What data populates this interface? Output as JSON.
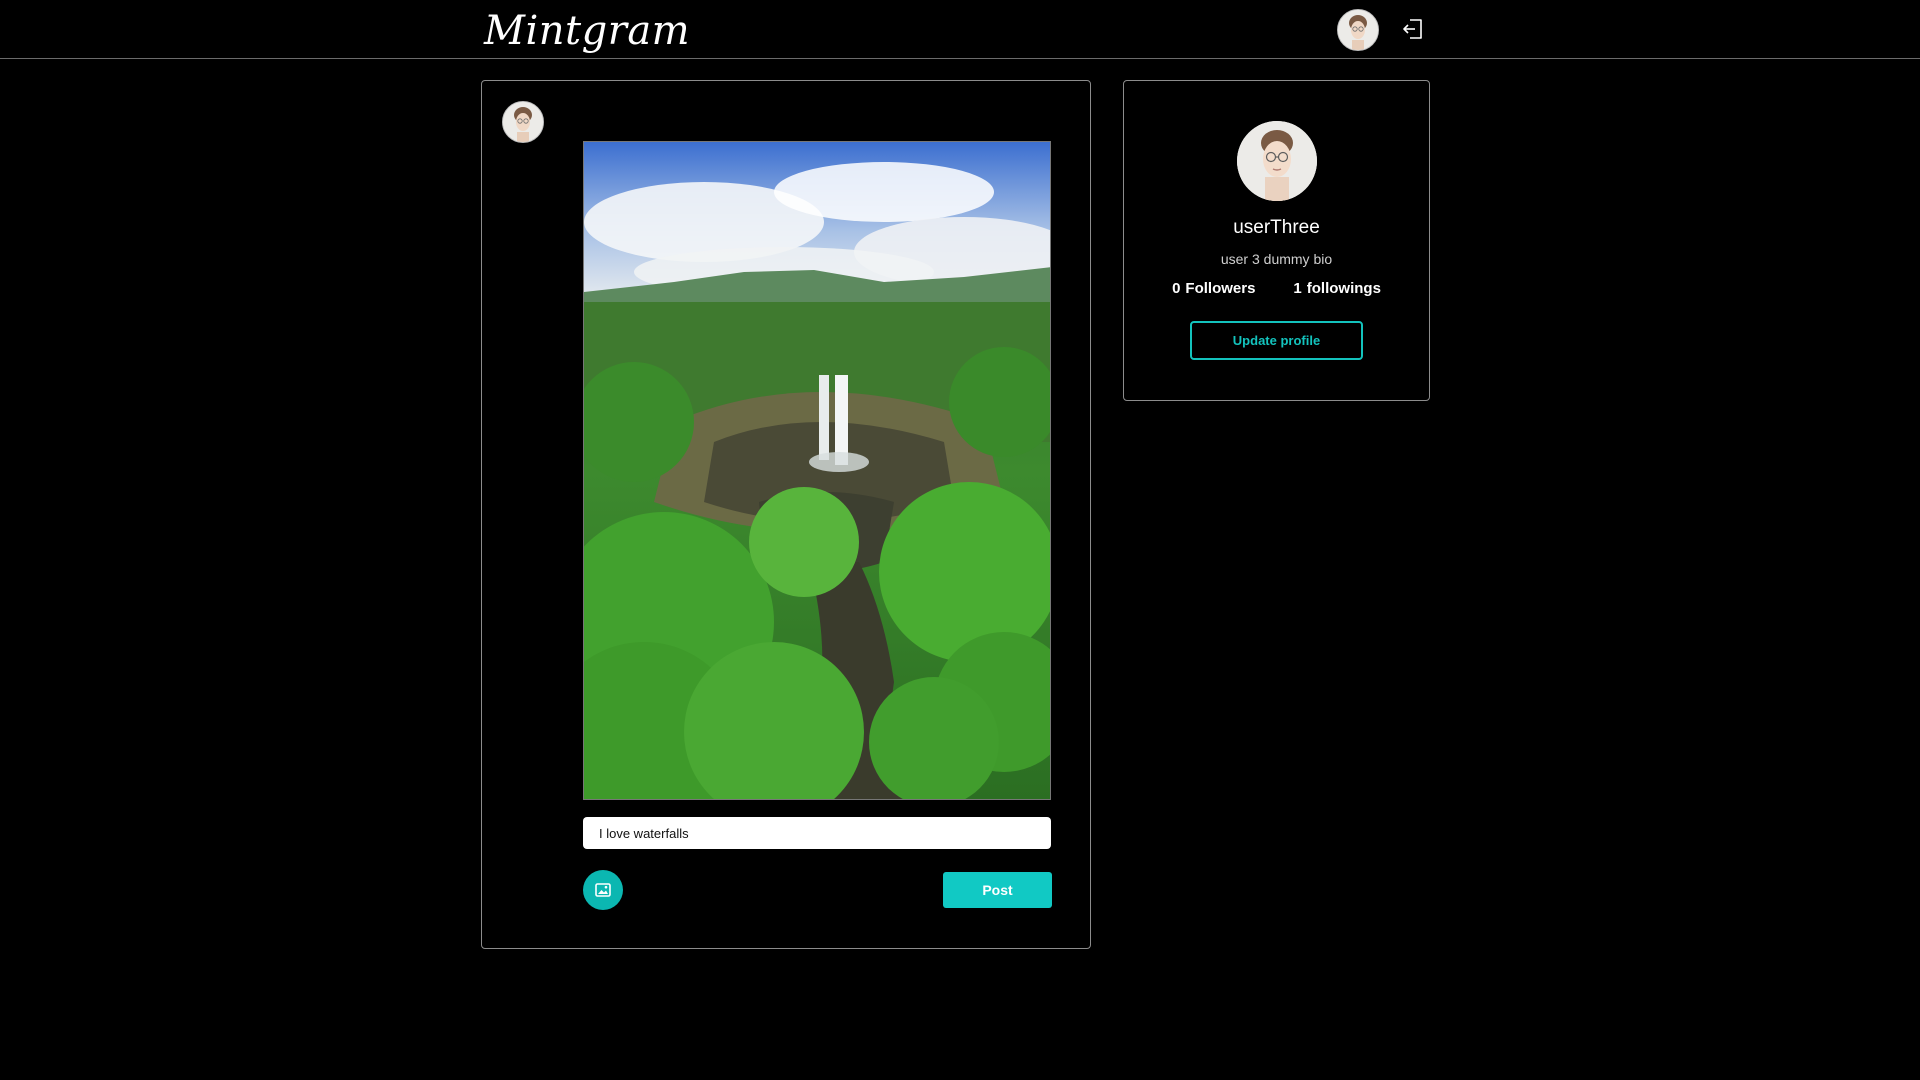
{
  "header": {
    "logo_text": "Mintgram",
    "avatar_alt": "user avatar",
    "logout_icon": "logout-icon"
  },
  "post_composer": {
    "image_alt": "waterfall in a green forest",
    "caption_value": "I love waterfalls",
    "image_button_icon": "image-icon",
    "post_label": "Post"
  },
  "profile": {
    "name": "userThree",
    "bio": "user 3 dummy bio",
    "followers_count": "0",
    "followers_label": "Followers",
    "followings_count": "1",
    "followings_label": "followings",
    "update_label": "Update profile"
  },
  "colors": {
    "accent": "#11c9c4",
    "background": "#000000",
    "border": "#8c8c8c"
  }
}
